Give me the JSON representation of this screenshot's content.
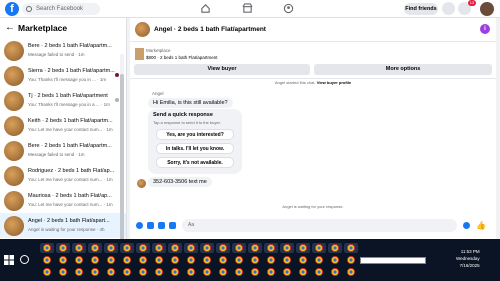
{
  "search": {
    "placeholder": "Search Facebook"
  },
  "header": {
    "find_friends": "Find friends",
    "notification_count": "13"
  },
  "sidebar": {
    "title": "Marketplace",
    "items": [
      {
        "title": "Bere · 2 beds 1 bath Flat/apartm...",
        "sub": "Message failed to send · 1m",
        "dot": false
      },
      {
        "title": "Sierra · 2 beds 1 bath Flat/apartm...",
        "sub": "You: Thanks I'll message you in ... · 1m",
        "dot": true
      },
      {
        "title": "Tj · 2 beds 1 bath Flat/apartment",
        "sub": "You: Thanks I'll message you in a ... · 1m",
        "dot": true
      },
      {
        "title": "Keith · 2 beds 1 bath Flat/apartm...",
        "sub": "You: Let me have your contact num... · 1m",
        "dot": false
      },
      {
        "title": "Bere · 2 beds 1 bath Flat/apartm...",
        "sub": "Message failed to send · 1m",
        "dot": false
      },
      {
        "title": "Rodriguez · 2 beds 1 bath Flat/ap...",
        "sub": "You: Let me have your contact num... · 1m",
        "dot": false
      },
      {
        "title": "Mauriosa · 2 beds 1 bath Flat/ap...",
        "sub": "You: Let me have your contact num... · 1m",
        "dot": false
      },
      {
        "title": "Angel · 2 beds 1 bath Flat/apart...",
        "sub": "Angel is waiting for your response · 4h",
        "dot": false
      }
    ]
  },
  "chat": {
    "title": "Angel · 2 beds 1 bath Flat/apartment",
    "listing_kind": "Marketplace",
    "listing_price": "$800 · 2 beds 1 bath Flat/apartment",
    "view_buyer": "View buyer",
    "more_options": "More options",
    "started_prefix": "Angel started this chat.",
    "started_link": "View buyer profile",
    "sender": "Angel",
    "msg1": "Hi Emilia, is this still available?",
    "quick_title": "Send a quick response",
    "quick_sub": "Tap a response to send it to the buyer.",
    "options": [
      "Yes, are you interested?",
      "In talks. I'll let you know.",
      "Sorry, it's not available."
    ],
    "msg2": "352-603-3506  text me",
    "waiting": "Angel is waiting for your response.",
    "compose_placeholder": "Aa"
  },
  "taskbar": {
    "time": "11:53 PM",
    "day": "Wednesday",
    "date": "7/16/2025"
  }
}
